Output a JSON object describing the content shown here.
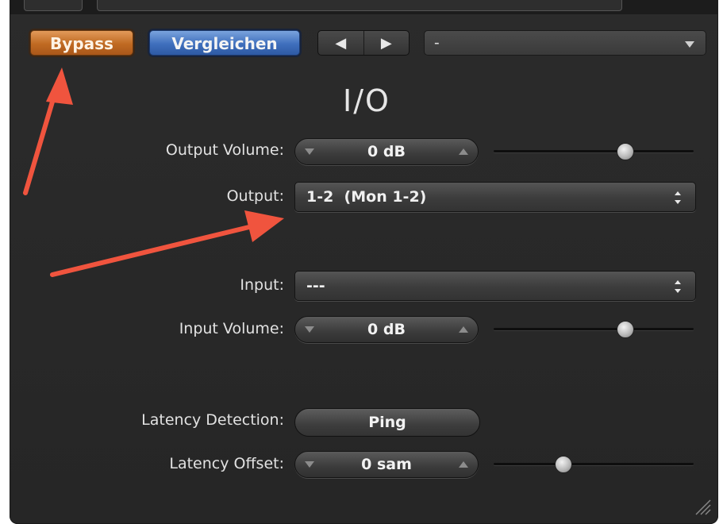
{
  "toolbar": {
    "bypass_label": "Bypass",
    "compare_label": "Vergleichen",
    "prev_glyph": "◀",
    "next_glyph": "▶",
    "preset_value": "-"
  },
  "section_title": "I/O",
  "rows": {
    "output_volume": {
      "label": "Output Volume:",
      "value": "0 dB",
      "slider_level": 0.66
    },
    "output": {
      "label": "Output:",
      "value": "1-2  (Mon 1-2)"
    },
    "input": {
      "label": "Input:",
      "value": "---"
    },
    "input_volume": {
      "label": "Input Volume:",
      "value": "0 dB",
      "slider_level": 0.66
    },
    "latency_detection": {
      "label": "Latency Detection:",
      "button_label": "Ping"
    },
    "latency_offset": {
      "label": "Latency Offset:",
      "value": "0 sam",
      "slider_level": 0.35
    }
  },
  "colors": {
    "panel_bg": "#2a2a2a",
    "bypass_orange": "#c06a22",
    "compare_blue": "#3f6fbd",
    "annotation_arrow": "#f0543e"
  },
  "icons": {
    "prev": "triangle-left-icon",
    "next": "triangle-right-icon",
    "dropdown": "chevron-down-icon",
    "popup": "up-down-arrows-icon",
    "stepper_down": "triangle-down-icon",
    "stepper_up": "triangle-up-icon",
    "grip": "resize-grip-icon"
  }
}
